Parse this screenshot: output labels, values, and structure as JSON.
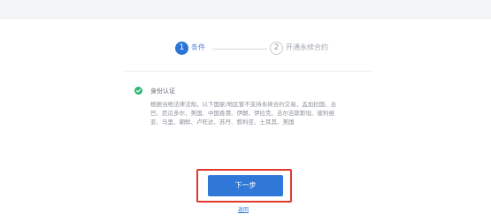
{
  "steps": [
    {
      "number": "1",
      "label": "条件",
      "state": "active"
    },
    {
      "number": "2",
      "label": "开通永续合约",
      "state": "inactive"
    }
  ],
  "identity": {
    "title": "身份认证",
    "notice": "根据当地法律法规，以下国家/地区暂不支持永续合约交易，孟加拉国、古巴、厄瓜多尔、美国、中国香港、伊朗、伊拉克、吉尔吉斯斯坦、玻利维亚、马里、朝鲜、卢旺达、苏丹、叙利亚、土耳其、美国",
    "status_icon": "check-circle-icon"
  },
  "actions": {
    "next_label": "下一步",
    "back_label": "返回"
  },
  "colors": {
    "accent": "#2f78d8",
    "success": "#2bb673",
    "highlight": "#e03a2f"
  }
}
